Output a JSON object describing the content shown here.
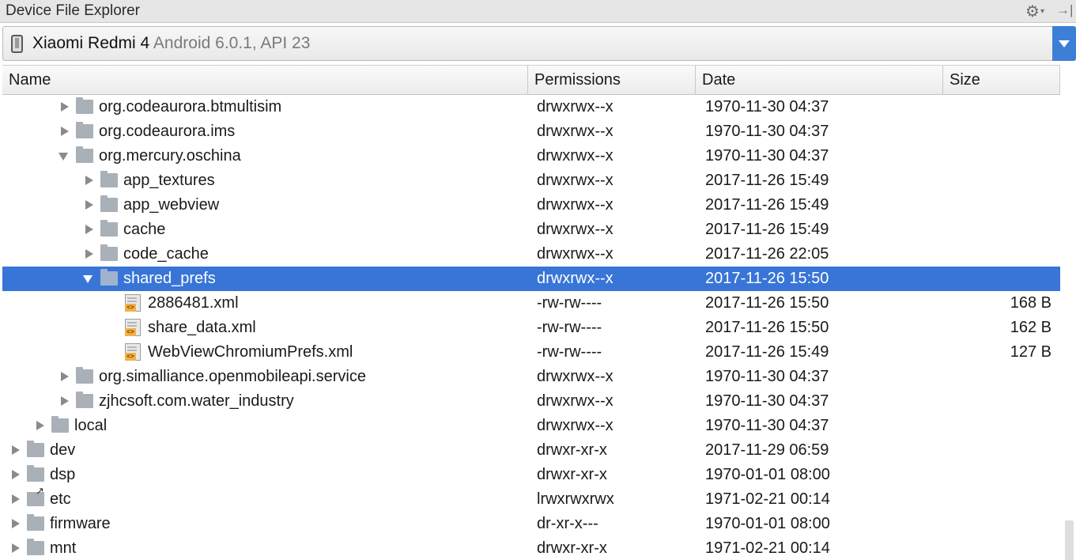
{
  "panel": {
    "title": "Device File Explorer",
    "gear_icon": "gear-icon",
    "hide_icon": "hide-panel-icon"
  },
  "device": {
    "name": "Xiaomi Redmi 4",
    "version": "Android 6.0.1, API 23",
    "icon": "phone-icon"
  },
  "columns": [
    "Name",
    "Permissions",
    "Date",
    "Size"
  ],
  "rows": [
    {
      "name": "org.codeaurora.btmultisim",
      "perm": "drwxrwx--x",
      "date": "1970-11-30 04:37",
      "size": "",
      "type": "folder",
      "state": "collapsed",
      "depth": 2,
      "selected": false
    },
    {
      "name": "org.codeaurora.ims",
      "perm": "drwxrwx--x",
      "date": "1970-11-30 04:37",
      "size": "",
      "type": "folder",
      "state": "collapsed",
      "depth": 2,
      "selected": false
    },
    {
      "name": "org.mercury.oschina",
      "perm": "drwxrwx--x",
      "date": "1970-11-30 04:37",
      "size": "",
      "type": "folder",
      "state": "expanded",
      "depth": 2,
      "selected": false
    },
    {
      "name": "app_textures",
      "perm": "drwxrwx--x",
      "date": "2017-11-26 15:49",
      "size": "",
      "type": "folder",
      "state": "collapsed",
      "depth": 3,
      "selected": false
    },
    {
      "name": "app_webview",
      "perm": "drwxrwx--x",
      "date": "2017-11-26 15:49",
      "size": "",
      "type": "folder",
      "state": "collapsed",
      "depth": 3,
      "selected": false
    },
    {
      "name": "cache",
      "perm": "drwxrwx--x",
      "date": "2017-11-26 15:49",
      "size": "",
      "type": "folder",
      "state": "collapsed",
      "depth": 3,
      "selected": false
    },
    {
      "name": "code_cache",
      "perm": "drwxrwx--x",
      "date": "2017-11-26 22:05",
      "size": "",
      "type": "folder",
      "state": "collapsed",
      "depth": 3,
      "selected": false
    },
    {
      "name": "shared_prefs",
      "perm": "drwxrwx--x",
      "date": "2017-11-26 15:50",
      "size": "",
      "type": "folder",
      "state": "expanded",
      "depth": 3,
      "selected": true
    },
    {
      "name": "2886481.xml",
      "perm": "-rw-rw----",
      "date": "2017-11-26 15:50",
      "size": "168 B",
      "type": "xml",
      "state": "leaf",
      "depth": 4,
      "selected": false
    },
    {
      "name": "share_data.xml",
      "perm": "-rw-rw----",
      "date": "2017-11-26 15:50",
      "size": "162 B",
      "type": "xml",
      "state": "leaf",
      "depth": 4,
      "selected": false
    },
    {
      "name": "WebViewChromiumPrefs.xml",
      "perm": "-rw-rw----",
      "date": "2017-11-26 15:49",
      "size": "127 B",
      "type": "xml",
      "state": "leaf",
      "depth": 4,
      "selected": false
    },
    {
      "name": "org.simalliance.openmobileapi.service",
      "perm": "drwxrwx--x",
      "date": "1970-11-30 04:37",
      "size": "",
      "type": "folder",
      "state": "collapsed",
      "depth": 2,
      "selected": false
    },
    {
      "name": "zjhcsoft.com.water_industry",
      "perm": "drwxrwx--x",
      "date": "1970-11-30 04:37",
      "size": "",
      "type": "folder",
      "state": "collapsed",
      "depth": 2,
      "selected": false
    },
    {
      "name": "local",
      "perm": "drwxrwx--x",
      "date": "1970-11-30 04:37",
      "size": "",
      "type": "folder",
      "state": "collapsed",
      "depth": 1,
      "selected": false
    },
    {
      "name": "dev",
      "perm": "drwxr-xr-x",
      "date": "2017-11-29 06:59",
      "size": "",
      "type": "folder",
      "state": "collapsed",
      "depth": 0,
      "selected": false
    },
    {
      "name": "dsp",
      "perm": "drwxr-xr-x",
      "date": "1970-01-01 08:00",
      "size": "",
      "type": "folder",
      "state": "collapsed",
      "depth": 0,
      "selected": false
    },
    {
      "name": "etc",
      "perm": "lrwxrwxrwx",
      "date": "1971-02-21 00:14",
      "size": "",
      "type": "link",
      "state": "collapsed",
      "depth": 0,
      "selected": false
    },
    {
      "name": "firmware",
      "perm": "dr-xr-x---",
      "date": "1970-01-01 08:00",
      "size": "",
      "type": "folder",
      "state": "collapsed",
      "depth": 0,
      "selected": false
    },
    {
      "name": "mnt",
      "perm": "drwxr-xr-x",
      "date": "1971-02-21 00:14",
      "size": "",
      "type": "folder",
      "state": "collapsed",
      "depth": 0,
      "selected": false
    }
  ]
}
